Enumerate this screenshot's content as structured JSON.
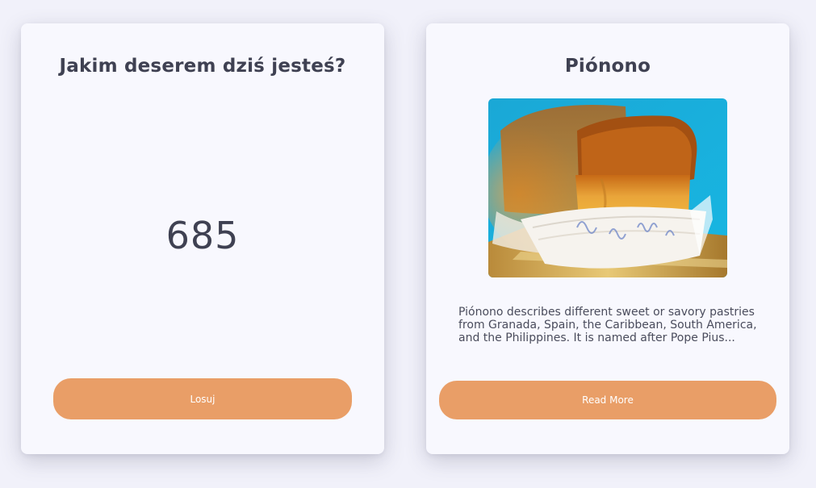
{
  "quiz_card": {
    "title": "Jakim deserem dziś jesteś?",
    "number": "685",
    "button_label": "Losuj"
  },
  "dessert_card": {
    "title": "Piónono",
    "image_alt": "Piononos in paper cups on a blue background",
    "description": "Piónono describes different sweet or savory pastries from Granada, Spain, the Caribbean, South America, and the Philippines. It is named after Pope Pius...",
    "button_label": "Read More"
  },
  "colors": {
    "background": "#f1f1fa",
    "card": "#f8f8fe",
    "button": "#e99e67",
    "text": "#3f4152"
  }
}
